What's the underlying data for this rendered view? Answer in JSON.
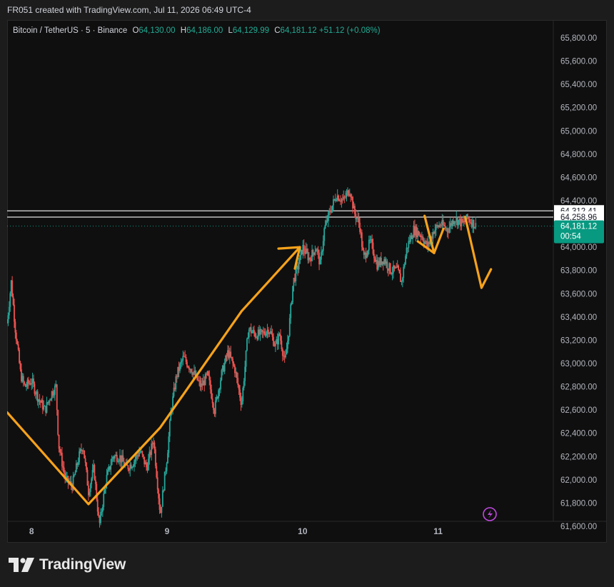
{
  "header": {
    "credit": "FR051 created with TradingView.com, Jul 11, 2026 06:49 UTC-4"
  },
  "legend": {
    "symbol": "Bitcoin / TetherUS · 5 · Binance",
    "o_label": "O",
    "o_value": "64,130.00",
    "h_label": "H",
    "h_value": "64,186.00",
    "l_label": "L",
    "l_value": "64,129.99",
    "c_label": "C",
    "c_value": "64,181.12 +51.12 (+0.08%)"
  },
  "price_tags": {
    "line1": "64,312.41",
    "line2": "64,258.96",
    "last": "64,181.12",
    "countdown": "00:54"
  },
  "brand": {
    "name": "TradingView"
  },
  "colors": {
    "up": "#26a69a",
    "down": "#ef5350",
    "arrow": "#f7a21b",
    "last_price": "#089981",
    "bg": "#0f0f0f"
  },
  "chart_data": {
    "type": "candlestick",
    "title": "Bitcoin / TetherUS · 5 · Binance",
    "y_axis": {
      "ticks": [
        61600,
        61800,
        62000,
        62200,
        62400,
        62600,
        62800,
        63000,
        63200,
        63400,
        63600,
        63800,
        64000,
        64200,
        64400,
        64600,
        64800,
        65000,
        65200,
        65400,
        65600,
        65800
      ],
      "tick_labels": [
        "61,600.00",
        "61,800.00",
        "62,000.00",
        "62,200.00",
        "62,400.00",
        "62,600.00",
        "62,800.00",
        "63,000.00",
        "63,200.00",
        "63,400.00",
        "63,600.00",
        "63,800.00",
        "64,000.00",
        "64,200.00",
        "64,400.00",
        "64,600.00",
        "64,800.00",
        "65,000.00",
        "65,200.00",
        "65,400.00",
        "65,600.00",
        "65,800.00"
      ],
      "range": [
        61520,
        65880
      ]
    },
    "x_axis": {
      "labels": [
        "8",
        "9",
        "10",
        "11"
      ],
      "label_days": [
        8,
        9,
        10,
        11
      ],
      "range_days": [
        7.82,
        11.85
      ]
    },
    "horizontal_lines": [
      64312.41,
      64258.96
    ],
    "last_price": 64181.12,
    "price_path": [
      [
        7.82,
        63350
      ],
      [
        7.85,
        63700
      ],
      [
        7.88,
        63300
      ],
      [
        7.92,
        62900
      ],
      [
        7.95,
        62800
      ],
      [
        8.0,
        62850
      ],
      [
        8.05,
        62700
      ],
      [
        8.1,
        62600
      ],
      [
        8.15,
        62750
      ],
      [
        8.18,
        62800
      ],
      [
        8.2,
        62300
      ],
      [
        8.25,
        62000
      ],
      [
        8.3,
        61950
      ],
      [
        8.35,
        62200
      ],
      [
        8.38,
        62300
      ],
      [
        8.42,
        61900
      ],
      [
        8.46,
        62100
      ],
      [
        8.5,
        61600
      ],
      [
        8.55,
        62000
      ],
      [
        8.6,
        62200
      ],
      [
        8.65,
        62200
      ],
      [
        8.7,
        62100
      ],
      [
        8.75,
        62150
      ],
      [
        8.8,
        62250
      ],
      [
        8.85,
        62100
      ],
      [
        8.9,
        62350
      ],
      [
        8.95,
        61700
      ],
      [
        9.0,
        62200
      ],
      [
        9.03,
        62600
      ],
      [
        9.07,
        62900
      ],
      [
        9.12,
        63050
      ],
      [
        9.18,
        62950
      ],
      [
        9.25,
        62800
      ],
      [
        9.3,
        62900
      ],
      [
        9.35,
        62600
      ],
      [
        9.4,
        62900
      ],
      [
        9.45,
        63100
      ],
      [
        9.5,
        62950
      ],
      [
        9.55,
        62650
      ],
      [
        9.6,
        63300
      ],
      [
        9.65,
        63250
      ],
      [
        9.7,
        63250
      ],
      [
        9.75,
        63300
      ],
      [
        9.8,
        63150
      ],
      [
        9.83,
        63250
      ],
      [
        9.87,
        63000
      ],
      [
        9.9,
        63300
      ],
      [
        9.93,
        63700
      ],
      [
        9.97,
        63850
      ],
      [
        10.0,
        64000
      ],
      [
        10.05,
        63900
      ],
      [
        10.1,
        64000
      ],
      [
        10.13,
        63850
      ],
      [
        10.16,
        64150
      ],
      [
        10.2,
        64300
      ],
      [
        10.25,
        64450
      ],
      [
        10.3,
        64400
      ],
      [
        10.35,
        64500
      ],
      [
        10.38,
        64300
      ],
      [
        10.42,
        64200
      ],
      [
        10.45,
        63900
      ],
      [
        10.5,
        64050
      ],
      [
        10.55,
        63850
      ],
      [
        10.6,
        63900
      ],
      [
        10.65,
        63800
      ],
      [
        10.7,
        63800
      ],
      [
        10.73,
        63700
      ],
      [
        10.77,
        64000
      ],
      [
        10.82,
        64150
      ],
      [
        10.88,
        64100
      ],
      [
        10.92,
        64000
      ],
      [
        10.97,
        64150
      ],
      [
        11.02,
        64200
      ],
      [
        11.07,
        64150
      ],
      [
        11.12,
        64250
      ],
      [
        11.18,
        64200
      ],
      [
        11.22,
        64250
      ],
      [
        11.28,
        64181
      ]
    ],
    "annotations": [
      {
        "kind": "arrow",
        "points": [
          [
            7.82,
            62580
          ],
          [
            8.42,
            61790
          ],
          [
            8.95,
            62450
          ],
          [
            9.55,
            63450
          ],
          [
            9.98,
            64000
          ]
        ]
      },
      {
        "kind": "arrow",
        "points": [
          [
            10.9,
            64270
          ],
          [
            10.97,
            63950
          ]
        ]
      },
      {
        "kind": "arrow",
        "points": [
          [
            10.85,
            64050
          ],
          [
            10.97,
            63950
          ],
          [
            11.04,
            64160
          ]
        ]
      },
      {
        "kind": "arrow",
        "points": [
          [
            11.2,
            64260
          ],
          [
            11.32,
            63650
          ],
          [
            11.39,
            63810
          ]
        ]
      }
    ],
    "grid": false
  }
}
